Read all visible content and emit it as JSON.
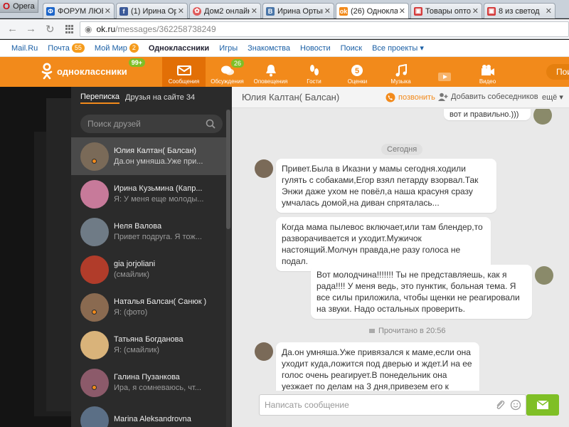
{
  "browser": {
    "opera_label": "Opera",
    "tabs": [
      {
        "title": "ФОРУМ ЛЮБИ",
        "color": "#1e66c9"
      },
      {
        "title": "(1) Ирина Орт",
        "color": "#3b5998"
      },
      {
        "title": "Дом2 онлайн",
        "color": "#e05a5a"
      },
      {
        "title": "Ирина Ортын",
        "color": "#4a76a8"
      },
      {
        "title": "(26) Однокла",
        "color": "#f28a1b"
      },
      {
        "title": "Товары опто",
        "color": "#d43a3a"
      },
      {
        "title": "8 из светод",
        "color": "#d43a3a"
      }
    ],
    "url_host": "ok.ru",
    "url_path": "/messages/362258738249"
  },
  "portal": {
    "items": [
      {
        "label": "Mail.Ru"
      },
      {
        "label": "Почта",
        "badge": "55"
      },
      {
        "label": "Мой Мир",
        "badge": "2"
      },
      {
        "label": "Одноклассники"
      },
      {
        "label": "Игры"
      },
      {
        "label": "Знакомства"
      },
      {
        "label": "Новости"
      },
      {
        "label": "Поиск"
      },
      {
        "label": "Все проекты ▾"
      }
    ]
  },
  "okheader": {
    "logo_text": "одноклассники",
    "logo_badge": "99+",
    "nav": [
      {
        "label": "Сообщения",
        "icon": "envelope-icon",
        "active": true
      },
      {
        "label": "Обсуждения",
        "icon": "discussions-icon",
        "count": "26"
      },
      {
        "label": "Оповещения",
        "icon": "bell-icon"
      },
      {
        "label": "Гости",
        "icon": "footprints-icon"
      },
      {
        "label": "Оценки",
        "icon": "rating-icon"
      },
      {
        "label": "Музыка",
        "icon": "music-icon"
      },
      {
        "label": "Видео",
        "icon": "video-icon"
      }
    ],
    "search_placeholder": "Пои"
  },
  "leftpanel": {
    "tab_chats": "Переписка",
    "tab_friends": "Друзья на сайте 34",
    "search_placeholder": "Поиск друзей",
    "friends": [
      {
        "name": "Юлия Калтан( Балсан)",
        "msg": "Да.он умняша.Уже при...",
        "online": true,
        "active": true,
        "color": "#7a6a58"
      },
      {
        "name": "Ирина Кузьмина (Капр...",
        "msg": "Я: У меня еще молоды...",
        "online": false,
        "color": "#c77a9a"
      },
      {
        "name": "Неля Валова",
        "msg": "Привет подруга. Я тож...",
        "online": false,
        "color": "#6f7b86"
      },
      {
        "name": "gia jorjoliani",
        "msg": "(смайлик)",
        "online": false,
        "color": "#b13c2a"
      },
      {
        "name": "Наталья Балсан( Санюк )",
        "msg": "Я: (фото)",
        "online": true,
        "color": "#8a6a50"
      },
      {
        "name": "Татьяна Богданова",
        "msg": "Я: (смайлик)",
        "online": false,
        "color": "#d9b37a"
      },
      {
        "name": "Галина Пузанкова",
        "msg": "Ира, я сомневаюсь, чт...",
        "online": true,
        "color": "#8c5a6a"
      },
      {
        "name": "Marina Aleksandrovna",
        "msg": "",
        "online": false,
        "color": "#5b6f86"
      }
    ]
  },
  "chat": {
    "title": "Юлия Калтан( Балсан)",
    "call_label": "позвонить",
    "add_label": "Добавить собеседников",
    "more_label": "ещё ▾",
    "top_snippet": "вот и правильно.)))",
    "date_label": "Сегодня",
    "messages": [
      {
        "text": "Привет.Была в Иказни у мамы сегодня.ходили гулять с собаками,Егор взял петарду взорвал.Так Энжи даже ухом не повёл,а наша красуня сразу умчалась домой,на диван спряталась..."
      },
      {
        "text": "Когда мама пылевос включает,или там блендер,то разворачивается и уходит.Мужичок настоящий.Молчун правда,не разу голоса не подал."
      },
      {
        "text": "Вот молодчина!!!!!!! Ты не представляешь, как я рада!!!! У меня ведь, это пунктик, больная тема. Я все силы приложила, чтобы щенки не реагировали на звуки. Надо остальных проверить."
      },
      {
        "text": "Да.он умняша.Уже привязался к маме,если она уходит куда,ложится под дверью и ждет.И на ее голос очень реагирует.В понедельник она уезжает по делам на 3 дня,привезем его к нам,надеюсь,ему не будеточень грустно."
      }
    ],
    "read_note": "Прочитано в 20:56",
    "composer_placeholder": "Написать сообщение"
  }
}
